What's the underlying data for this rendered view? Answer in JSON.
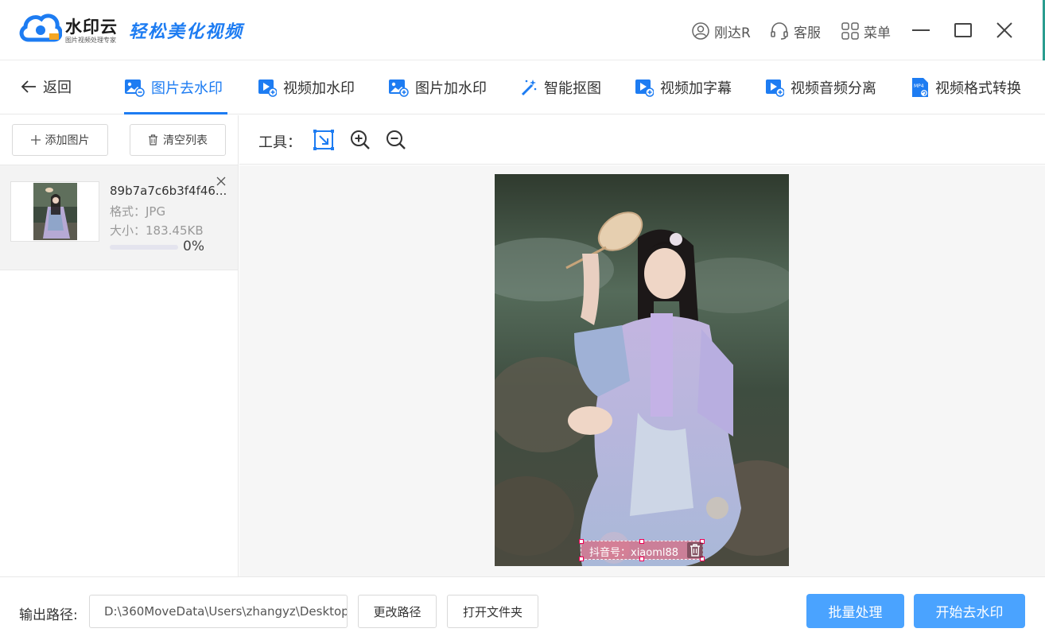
{
  "app": {
    "logo_name": "水印云",
    "logo_sub": "图片视频处理专家",
    "slogan": "轻松美化视频"
  },
  "titlebar": {
    "user_label": "刚达R",
    "service_label": "客服",
    "menu_label": "菜单"
  },
  "nav": {
    "back_label": "返回",
    "tabs": [
      {
        "label": "图片去水印",
        "icon": "image-remove-watermark-icon",
        "active": true
      },
      {
        "label": "视频加水印",
        "icon": "video-add-watermark-icon",
        "active": false
      },
      {
        "label": "图片加水印",
        "icon": "image-add-watermark-icon",
        "active": false
      },
      {
        "label": "智能抠图",
        "icon": "magic-wand-icon",
        "active": false
      },
      {
        "label": "视频加字幕",
        "icon": "video-subtitle-icon",
        "active": false
      },
      {
        "label": "视频音频分离",
        "icon": "video-audio-split-icon",
        "active": false
      },
      {
        "label": "视频格式转换",
        "icon": "mp4-file-icon",
        "active": false
      }
    ]
  },
  "left_panel": {
    "add_button": "添加图片",
    "clear_button": "清空列表",
    "files": [
      {
        "name": "89b7a7c6b3f4f46...",
        "format": "格式：JPG",
        "size": "大小：183.45KB",
        "progress_text": "0%",
        "progress": 0
      }
    ]
  },
  "toolbar": {
    "label": "工具："
  },
  "canvas": {
    "watermark_text": "抖音号：xiaoml88"
  },
  "footer": {
    "output_label": "输出路径:",
    "output_path": "D:\\360MoveData\\Users\\zhangyz\\Desktop",
    "change_path_button": "更改路径",
    "open_folder_button": "打开文件夹",
    "batch_button": "批量处理",
    "start_button": "开始去水印"
  },
  "colors": {
    "accent": "#1d7cf2",
    "primary_button": "#4aa3ff"
  }
}
